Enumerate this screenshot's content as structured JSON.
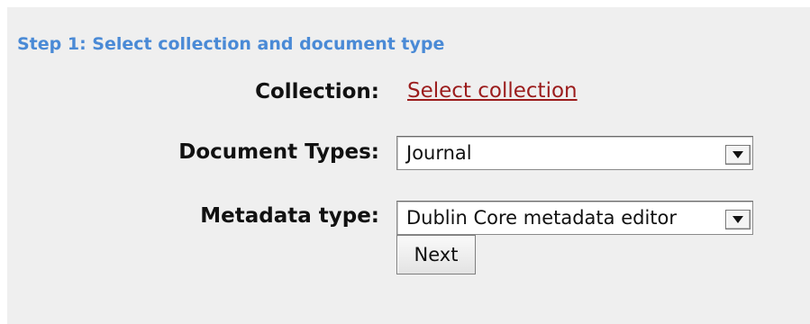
{
  "form": {
    "step_heading": "Step 1: Select collection and document type",
    "collection": {
      "label": "Collection:",
      "link_text": "Select collection"
    },
    "document_types": {
      "label": "Document Types:",
      "selected": "Journal"
    },
    "metadata_type": {
      "label": "Metadata type:",
      "selected": "Dublin Core metadata editor"
    },
    "next_label": "Next"
  },
  "colors": {
    "heading": "#4a8ad6",
    "link": "#9b1c1c",
    "panel_background": "#efefef"
  },
  "icons": {
    "select_arrow": "chevron-down-icon"
  }
}
